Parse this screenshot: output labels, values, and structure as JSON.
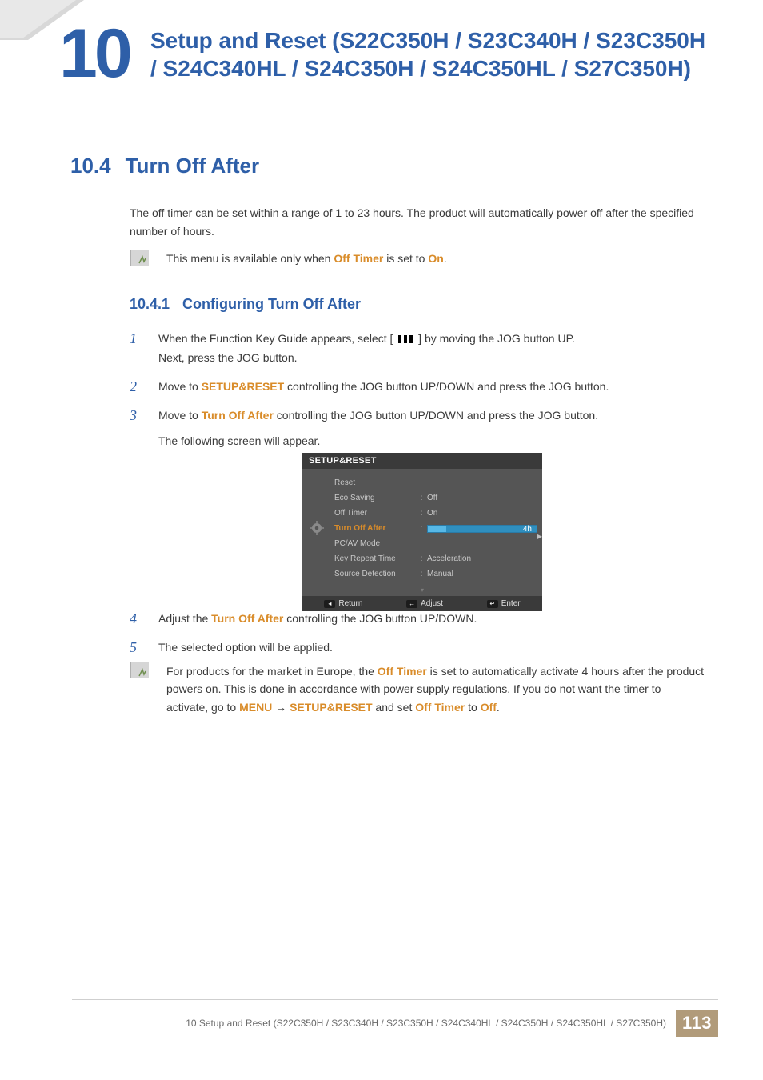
{
  "chapter_number": "10",
  "chapter_title": "Setup and Reset (S22C350H / S23C340H / S23C350H / S24C340HL / S24C350H / S24C350HL / S27C350H)",
  "section": {
    "num": "10.4",
    "title": "Turn Off After"
  },
  "intro": "The off timer can be set within a range of 1 to 23 hours. The product will automatically power off after the specified number of hours.",
  "note1": {
    "pre": "This menu is available only when ",
    "b1": "Off Timer",
    "mid": " is set to ",
    "b2": "On",
    "post": "."
  },
  "subsection": {
    "num": "10.4.1",
    "title": "Configuring Turn Off After"
  },
  "steps": {
    "s1a": "When the Function Key Guide appears, select ",
    "s1b": " by moving the JOG button UP.",
    "s1c": "Next, press the JOG button.",
    "s2a": "Move to ",
    "s2b": "SETUP&RESET",
    "s2c": " controlling the JOG button UP/DOWN and press the JOG button.",
    "s3a": "Move to ",
    "s3b": "Turn Off After",
    "s3c": " controlling the JOG button UP/DOWN and press the JOG button.",
    "s3d": "The following screen will appear.",
    "s4a": "Adjust the ",
    "s4b": "Turn Off After",
    "s4c": " controlling the JOG button UP/DOWN.",
    "s5": "The selected option will be applied."
  },
  "osd": {
    "title": "SETUP&RESET",
    "rows": [
      {
        "label": "Reset",
        "val": ""
      },
      {
        "label": "Eco Saving",
        "val": "Off"
      },
      {
        "label": "Off Timer",
        "val": "On"
      },
      {
        "label": "Turn Off After",
        "val": "4h",
        "slider": true,
        "selected": true
      },
      {
        "label": "PC/AV Mode",
        "val": ""
      },
      {
        "label": "Key Repeat Time",
        "val": "Acceleration"
      },
      {
        "label": "Source Detection",
        "val": "Manual"
      }
    ],
    "footer": {
      "return": "Return",
      "adjust": "Adjust",
      "enter": "Enter"
    }
  },
  "note2": {
    "t1": "For products for the market in Europe, the ",
    "b1": "Off Timer",
    "t2": " is set to automatically activate 4 hours after the product powers on. This is done in accordance with power supply regulations. If you do not want the timer to activate, go to ",
    "b2": "MENU",
    "arrow": " → ",
    "b3": "SETUP&RESET",
    "t3": " and set ",
    "b4": "Off Timer",
    "t4": " to ",
    "b5": "Off",
    "t5": "."
  },
  "footer": {
    "chapter_line": "10 Setup and Reset (S22C350H / S23C340H / S23C350H / S24C340HL / S24C350H / S24C350HL / S27C350H)",
    "page": "113"
  }
}
